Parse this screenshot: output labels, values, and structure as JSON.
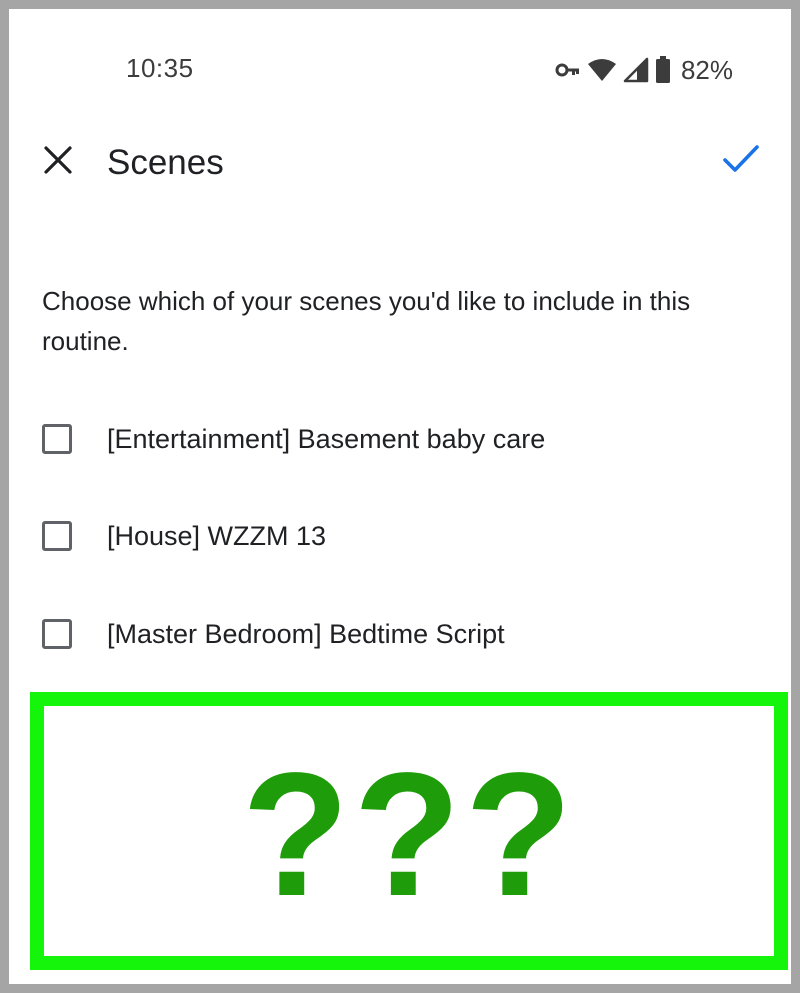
{
  "status_bar": {
    "time": "10:35",
    "icons": [
      "vpn-key-icon",
      "wifi-icon",
      "cell-signal-icon",
      "battery-icon"
    ],
    "battery_percent": "82%"
  },
  "header": {
    "close_icon": "close-icon",
    "title": "Scenes",
    "confirm_icon": "check-icon",
    "accent_color": "#1a73e8"
  },
  "description": "Choose which of your scenes you'd like to include in this routine.",
  "scenes": [
    {
      "label": "[Entertainment] Basement baby care",
      "checked": false
    },
    {
      "label": "[House] WZZM 13",
      "checked": false
    },
    {
      "label": "[Master Bedroom] Bedtime Script",
      "checked": false
    }
  ],
  "overlay": {
    "text": "???",
    "border_color": "#15f50b",
    "text_color": "#1f9c09"
  }
}
